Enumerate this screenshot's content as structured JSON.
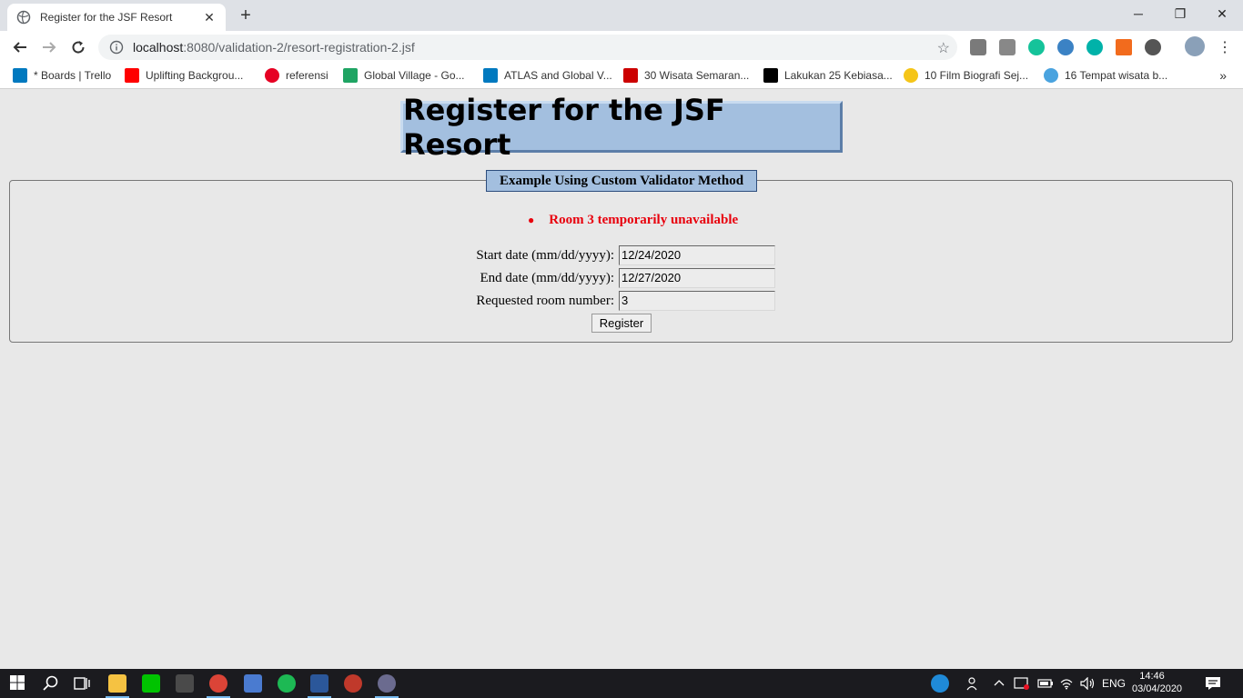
{
  "browser": {
    "tab_title": "Register for the JSF Resort",
    "url_host": "localhost",
    "url_rest": ":8080/validation-2/resort-registration-2.jsf",
    "bookmarks": [
      {
        "label": "* Boards | Trello",
        "color": "#0079bf"
      },
      {
        "label": "Uplifting Backgrou...",
        "color": "#ff0000"
      },
      {
        "label": "referensi",
        "color": "#e60023"
      },
      {
        "label": "Global Village - Go...",
        "color": "#1fa463"
      },
      {
        "label": "ATLAS and Global V...",
        "color": "#0079bf"
      },
      {
        "label": "30 Wisata Semaran...",
        "color": "#cc0000"
      },
      {
        "label": "Lakukan 25 Kebiasa...",
        "color": "#000000"
      },
      {
        "label": "10 Film Biografi Sej...",
        "color": "#f5c518"
      },
      {
        "label": "16 Tempat wisata b...",
        "color": "#4aa3df"
      }
    ],
    "more_bookmarks": "»"
  },
  "page": {
    "heading": "Register for the JSF Resort",
    "legend": "Example Using Custom Validator Method",
    "error_message": "Room 3 temporarily unavailable",
    "fields": {
      "start_label": "Start date (mm/dd/yyyy):",
      "start_value": "12/24/2020",
      "end_label": "End date (mm/dd/yyyy):",
      "end_value": "12/27/2020",
      "room_label": "Requested room number:",
      "room_value": "3"
    },
    "submit_label": "Register"
  },
  "taskbar": {
    "language": "ENG",
    "time": "14:46",
    "date": "03/04/2020"
  },
  "colors": {
    "heading_bg": "#a3bfdf",
    "error": "#e8000d"
  }
}
